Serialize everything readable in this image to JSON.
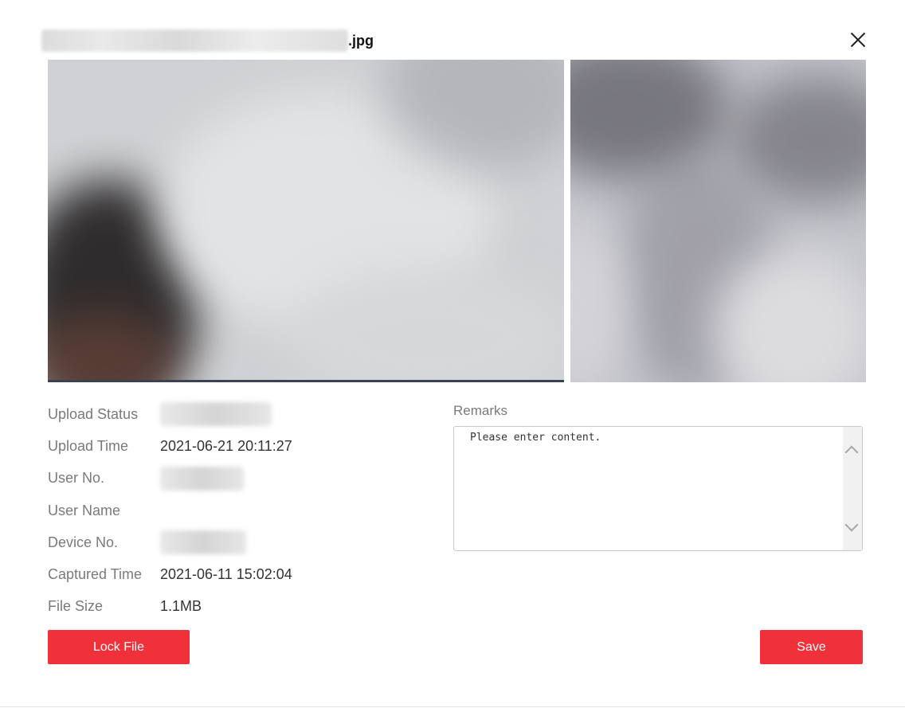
{
  "dialog": {
    "title_extension": ".jpg"
  },
  "info": {
    "upload_status_label": "Upload Status",
    "upload_time_label": "Upload Time",
    "upload_time_value": "2021-06-21 20:11:27",
    "user_no_label": "User No.",
    "user_name_label": "User Name",
    "device_no_label": "Device No.",
    "captured_time_label": "Captured Time",
    "captured_time_value": "2021-06-11 15:02:04",
    "file_size_label": "File Size",
    "file_size_value": "1.1MB"
  },
  "remarks": {
    "label": "Remarks",
    "placeholder": "Please enter content."
  },
  "buttons": {
    "lock_file": "Lock File",
    "save": "Save"
  },
  "colors": {
    "accent": "#f1313a"
  },
  "icons": {
    "close": "close-icon",
    "scroll_up": "chevron-up-icon",
    "scroll_down": "chevron-down-icon"
  }
}
